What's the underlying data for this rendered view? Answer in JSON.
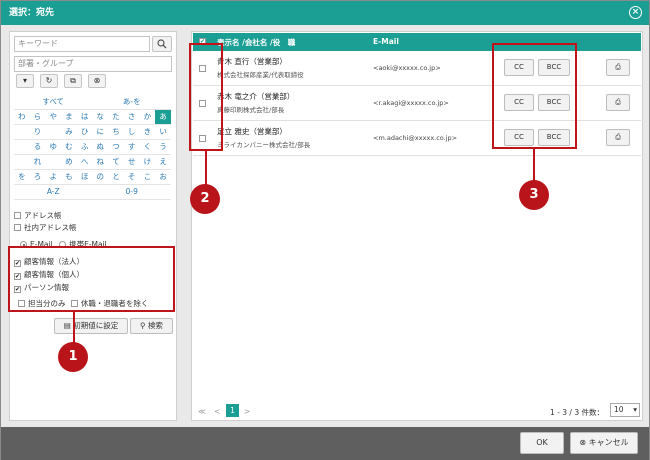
{
  "window": {
    "title": "選択：宛先"
  },
  "search": {
    "keyword_placeholder": "キーワード",
    "dept_placeholder": "部署・グループ"
  },
  "kana": {
    "rows": [
      [
        "すべて",
        "あ-を"
      ],
      [
        "わ",
        "ら",
        "や",
        "ま",
        "は",
        "な",
        "た",
        "さ",
        "か",
        "あ"
      ],
      [
        "",
        "り",
        "",
        "み",
        "ひ",
        "に",
        "ち",
        "し",
        "き",
        "い"
      ],
      [
        "",
        "る",
        "ゆ",
        "む",
        "ふ",
        "ぬ",
        "つ",
        "す",
        "く",
        "う"
      ],
      [
        "",
        "れ",
        "",
        "め",
        "へ",
        "ね",
        "て",
        "せ",
        "け",
        "え"
      ],
      [
        "を",
        "ろ",
        "よ",
        "も",
        "ほ",
        "の",
        "と",
        "そ",
        "こ",
        "お"
      ],
      [
        "A-Z",
        "0-9"
      ]
    ]
  },
  "options": {
    "address_book": "アドレス帳",
    "internal_address_book": "社内アドレス帳",
    "email": "E-Mail",
    "mobile_email": "携帯E-Mail",
    "customer_corp": "顧客情報（法人）",
    "customer_individual": "顧客情報（個人）",
    "person_info": "パーソン情報",
    "mine_only": "担当分のみ",
    "exclude_leave": "休職・退職者を除く"
  },
  "buttons": {
    "reset": "初期値に設定",
    "search": "検索",
    "ok": "OK",
    "cancel": "キャンセル",
    "cc": "CC",
    "bcc": "BCC"
  },
  "table": {
    "col_name": "表示名 /会社名 /役　職",
    "col_email": "E-Mail",
    "rows": [
      {
        "name": "青木 直行（営業部）",
        "org": "株式会社探郎産業/代表取締役",
        "email": "<aoki@xxxxx.co.jp>"
      },
      {
        "name": "赤木 竜之介（営業部）",
        "org": "真藤印刷株式会社/部長",
        "email": "<r.akagi@xxxxx.co.jp>"
      },
      {
        "name": "足立 雅史（営業部）",
        "org": "ミライカンパニー株式会社/部長",
        "email": "<m.adachi@xxxxx.co.jp>"
      }
    ]
  },
  "pager": {
    "first": "≪",
    "prev": "<",
    "current": "1",
    "next": ">",
    "summary": "1 - 3 / 3 件数：",
    "per_page": "10"
  },
  "markers": [
    "1",
    "2",
    "3"
  ],
  "colors": {
    "accent": "#1b9e93",
    "highlight": "#c0141b"
  }
}
